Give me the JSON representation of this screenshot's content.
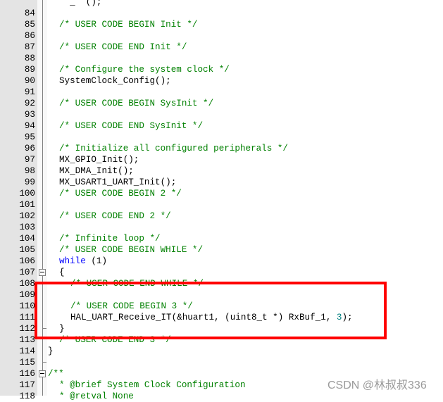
{
  "editor": {
    "lines": [
      {
        "n": "",
        "segments": [
          {
            "t": "  _  ();",
            "c": "code"
          }
        ]
      },
      {
        "n": "84",
        "segments": []
      },
      {
        "n": "85",
        "segments": [
          {
            "t": "/* USER CODE BEGIN Init */",
            "c": "comment"
          }
        ]
      },
      {
        "n": "86",
        "segments": []
      },
      {
        "n": "87",
        "segments": [
          {
            "t": "/* USER CODE END Init */",
            "c": "comment"
          }
        ]
      },
      {
        "n": "88",
        "segments": []
      },
      {
        "n": "89",
        "segments": [
          {
            "t": "/* Configure the system clock */",
            "c": "comment"
          }
        ]
      },
      {
        "n": "90",
        "segments": [
          {
            "t": "SystemClock_Config();",
            "c": "code"
          }
        ]
      },
      {
        "n": "91",
        "segments": []
      },
      {
        "n": "92",
        "segments": [
          {
            "t": "/* USER CODE BEGIN SysInit */",
            "c": "comment"
          }
        ]
      },
      {
        "n": "93",
        "segments": []
      },
      {
        "n": "94",
        "segments": [
          {
            "t": "/* USER CODE END SysInit */",
            "c": "comment"
          }
        ]
      },
      {
        "n": "95",
        "segments": []
      },
      {
        "n": "96",
        "segments": [
          {
            "t": "/* Initialize all configured peripherals */",
            "c": "comment"
          }
        ]
      },
      {
        "n": "97",
        "segments": [
          {
            "t": "MX_GPIO_Init();",
            "c": "code"
          }
        ]
      },
      {
        "n": "98",
        "segments": [
          {
            "t": "MX_DMA_Init();",
            "c": "code"
          }
        ]
      },
      {
        "n": "99",
        "segments": [
          {
            "t": "MX_USART1_UART_Init();",
            "c": "code"
          }
        ]
      },
      {
        "n": "100",
        "segments": [
          {
            "t": "/* USER CODE BEGIN 2 */",
            "c": "comment"
          }
        ]
      },
      {
        "n": "101",
        "segments": []
      },
      {
        "n": "102",
        "segments": [
          {
            "t": "/* USER CODE END 2 */",
            "c": "comment"
          }
        ]
      },
      {
        "n": "103",
        "segments": []
      },
      {
        "n": "104",
        "segments": [
          {
            "t": "/* Infinite loop */",
            "c": "comment"
          }
        ]
      },
      {
        "n": "105",
        "segments": [
          {
            "t": "/* USER CODE BEGIN WHILE */",
            "c": "comment"
          }
        ]
      },
      {
        "n": "106",
        "segments": [
          {
            "t": "while",
            "c": "kw"
          },
          {
            "t": " (1)",
            "c": "code"
          }
        ]
      },
      {
        "n": "107",
        "fold": "open",
        "segments": [
          {
            "t": "{",
            "c": "code"
          }
        ]
      },
      {
        "n": "108",
        "indent": 2,
        "segments": [
          {
            "t": "/* USER CODE END WHILE */",
            "c": "comment"
          }
        ]
      },
      {
        "n": "109",
        "segments": []
      },
      {
        "n": "110",
        "indent": 2,
        "segments": [
          {
            "t": "/* USER CODE BEGIN 3 */",
            "c": "comment"
          }
        ]
      },
      {
        "n": "111",
        "indent": 2,
        "segments": [
          {
            "t": "HAL_UART_Receive_IT(&huart1, (uint8_t *) RxBuf_1, ",
            "c": "code"
          },
          {
            "t": "3",
            "c": "num"
          },
          {
            "t": ");",
            "c": "code"
          }
        ]
      },
      {
        "n": "112",
        "fold": "end",
        "segments": [
          {
            "t": "}",
            "c": "code"
          }
        ]
      },
      {
        "n": "113",
        "segments": [
          {
            "t": "/* USER CODE END 3 */",
            "c": "comment"
          }
        ]
      },
      {
        "n": "114",
        "indent": 0,
        "segments": [
          {
            "t": "}",
            "c": "code"
          }
        ]
      },
      {
        "n": "115",
        "fold": "end",
        "segments": []
      },
      {
        "n": "116",
        "fold": "open",
        "indent": 0,
        "segments": [
          {
            "t": "/**",
            "c": "comment"
          }
        ]
      },
      {
        "n": "117",
        "segments": [
          {
            "t": "* @brief System Clock Configuration",
            "c": "comment"
          }
        ]
      },
      {
        "n": "118",
        "segments": [
          {
            "t": "* @retval None",
            "c": "comment"
          }
        ]
      }
    ]
  },
  "highlight": {
    "color": "#ff0000",
    "label": "highlighted-region"
  },
  "watermark": {
    "text": "CSDN @林叔叔336"
  },
  "colors": {
    "comment": "#008000",
    "keyword": "#0000ff",
    "number": "#008080",
    "gutter": "#e4e4e4"
  }
}
